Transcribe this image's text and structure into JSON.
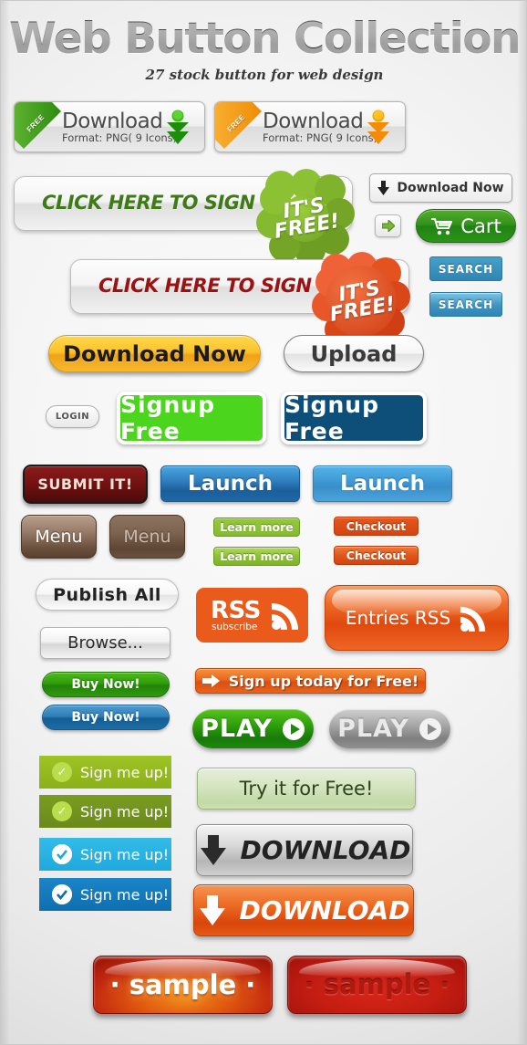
{
  "header": {
    "title": "Web Button Collection",
    "subtitle": "27 stock button for web design"
  },
  "download_cards": [
    {
      "ribbon": "FREE",
      "title": "Download",
      "format": "Format: PNG( 9 Icons)",
      "color": "#2e9a16",
      "ribbon_color": "#4aa81e"
    },
    {
      "ribbon": "FREE",
      "title": "Download",
      "format": "Format: PNG( 9 Icons)",
      "color": "#f59b0e",
      "ribbon_color": "#f2a01a"
    }
  ],
  "signup_bars": [
    {
      "label": "CLICK HERE TO SIGN UP",
      "text_color": "#3f7a18",
      "burst_text_1": "IT'S",
      "burst_text_2": "FREE!",
      "burst_color": "#84bb2c"
    },
    {
      "label": "CLICK HERE TO SIGN UP",
      "text_color": "#9b1212",
      "burst_text_1": "IT'S",
      "burst_text_2": "FREE!",
      "burst_color": "#e8532a"
    }
  ],
  "side_buttons": {
    "download_now": "Download Now",
    "arrow_icon": "arrow-right-icon",
    "cart": "Cart",
    "cart_icon": "shopping-cart-icon",
    "search_1": "SEARCH",
    "search_2": "SEARCH"
  },
  "row_download_upload": {
    "download_now": "Download Now",
    "upload": "Upload"
  },
  "row_signup": {
    "login": "LOGIN",
    "signup_green": "Signup Free",
    "signup_blue": "Signup Free"
  },
  "row_submit": {
    "submit": "SUBMIT IT!",
    "launch_1": "Launch",
    "launch_2": "Launch"
  },
  "row_menu": {
    "menu_1": "Menu",
    "menu_2": "Menu",
    "learn_more_1": "Learn more",
    "learn_more_2": "Learn more",
    "checkout_1": "Checkout",
    "checkout_2": "Checkout"
  },
  "row_publish": {
    "publish_all": "Publish  All",
    "browse": "Browse...",
    "buy_now_green": "Buy Now!",
    "buy_now_blue": "Buy Now!"
  },
  "rss": {
    "label": "RSS",
    "sub": "subscribe",
    "entries": "Entries RSS",
    "icon": "rss-icon"
  },
  "signup_today": {
    "label": "Sign up today for Free!",
    "arrow_icon": "arrow-right-icon"
  },
  "play": {
    "green": "PLAY",
    "silver": "PLAY",
    "icon": "play-icon"
  },
  "try_it": {
    "label": "Try it for Free!"
  },
  "sign_me_up": [
    {
      "label": "Sign me up!",
      "check_icon": "check-circle-icon"
    },
    {
      "label": "Sign me up!",
      "check_icon": "check-circle-icon"
    },
    {
      "label": "Sign me up!",
      "check_icon": "check-circle-icon"
    },
    {
      "label": "Sign me up!",
      "check_icon": "check-circle-icon"
    }
  ],
  "big_downloads": [
    {
      "label": "DOWNLOAD",
      "icon": "download-arrow-icon",
      "style": "grey"
    },
    {
      "label": "DOWNLOAD",
      "icon": "download-arrow-icon",
      "style": "orange"
    }
  ],
  "samples": [
    {
      "label": "· sample ·"
    },
    {
      "label": "· sample ·"
    }
  ],
  "colors": {
    "green": "#4aa81e",
    "orange": "#e8641d",
    "blue": "#1d6ca4",
    "red": "#c0260f",
    "page_bg": "#f2f2f2"
  }
}
